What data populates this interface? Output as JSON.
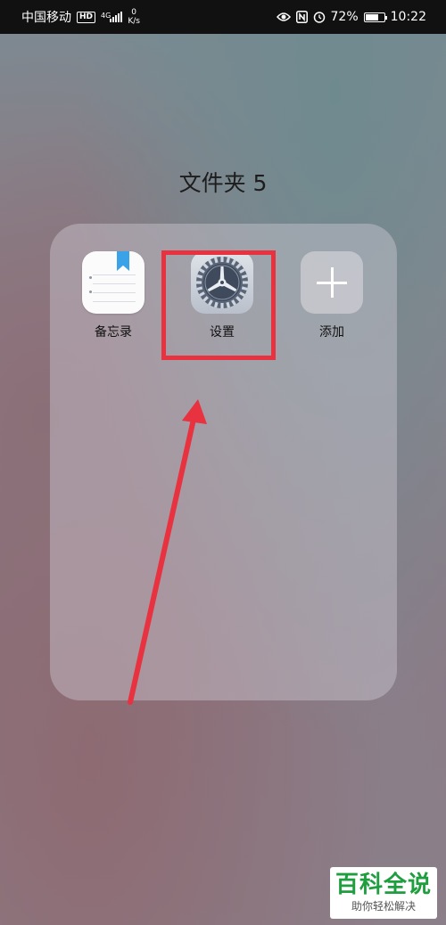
{
  "status_bar": {
    "carrier": "中国移动",
    "hd_label": "HD",
    "network_type": "4G",
    "net_speed_value": "0",
    "net_speed_unit": "K/s",
    "battery_percent": "72%",
    "battery_level": 0.72,
    "time": "10:22",
    "icons": [
      "eye-icon",
      "nfc-icon",
      "alarm-icon",
      "battery-icon"
    ]
  },
  "folder": {
    "title": "文件夹 5",
    "apps": [
      {
        "label": "备忘录",
        "icon": "memo-icon"
      },
      {
        "label": "设置",
        "icon": "settings-gear-icon"
      },
      {
        "label": "添加",
        "icon": "plus-icon"
      }
    ]
  },
  "annotation": {
    "color": "#e8323f"
  },
  "watermark": {
    "main": "百科全说",
    "sub": "助你轻松解决"
  }
}
